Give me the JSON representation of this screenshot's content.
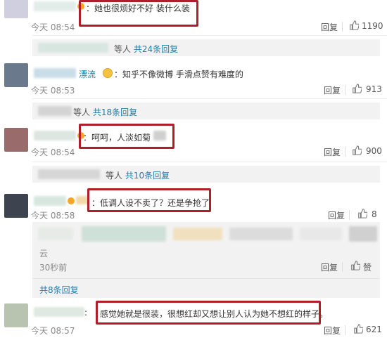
{
  "comments": [
    {
      "text": "：她也很烦好不好 装什么装",
      "time": "今天 08:54",
      "reply": "回复",
      "likes": "1190"
    },
    {
      "name_suffix": "漂流",
      "text": "：知乎不像微博 手滑点赞有难度的",
      "time": "今天 08:53",
      "reply": "回复",
      "likes": "913"
    },
    {
      "text": "：呵呵，人淡如菊",
      "time": "今天 08:54",
      "reply": "回复",
      "likes": "900"
    },
    {
      "text": "：低调人设不卖了？还是争抢了",
      "time": "今天 08:58",
      "reply": "回复",
      "likes": "8"
    },
    {
      "time": "30秒前",
      "reply": "回复",
      "likes": "赞"
    },
    {
      "text": "感觉她就是很装，很想红却又想让别人认为她不想红的样子。",
      "time": "今天 08:57",
      "reply": "回复",
      "likes": "621"
    }
  ],
  "reply_summaries": [
    {
      "who": "等人",
      "count": "共24条回复"
    },
    {
      "who": "等人",
      "count": "共18条回复"
    },
    {
      "who": "等人",
      "count": "共10条回复"
    },
    {
      "count": "共8条回复"
    }
  ],
  "partial_text": "云",
  "highlight_color": "#b01e2a",
  "link_color": "#1e7ea8"
}
